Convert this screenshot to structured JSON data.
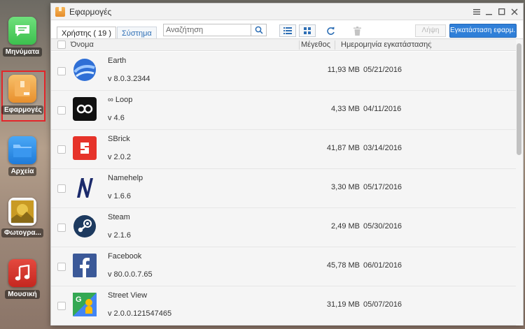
{
  "dock": {
    "items": [
      {
        "label": "Μηνύματα",
        "icon": "message-icon",
        "color": "#4cd964"
      },
      {
        "label": "Εφαρμογές",
        "icon": "apps-box-icon",
        "color": "#f0a23e"
      },
      {
        "label": "Αρχεία",
        "icon": "folder-icon",
        "color": "#2a8ee8"
      },
      {
        "label": "Φωτογρα...",
        "icon": "photo-icon",
        "color": "#c99a24"
      },
      {
        "label": "Μουσική",
        "icon": "music-icon",
        "color": "#d9342b"
      }
    ]
  },
  "window": {
    "title": "Εφαρμογές",
    "tabs": [
      {
        "label": "Χρήστης ( 19 )"
      },
      {
        "label": "Σύστημα"
      }
    ],
    "search": {
      "placeholder": "Αναζήτηση"
    },
    "uninstall_label": "Λήψη",
    "install_label": "Εγκατάσταση εφαρμ..."
  },
  "table": {
    "columns": {
      "name": "Όνομα",
      "size": "Μέγεθος",
      "date": "Ημερομηνία εγκατάστασης"
    },
    "rows": [
      {
        "name": "Earth",
        "version": "v 8.0.3.2344",
        "size": "11,93 MB",
        "date": "05/21/2016",
        "icon": "google-earth-icon"
      },
      {
        "name": "∞ Loop",
        "version": "v 4.6",
        "size": "4,33 MB",
        "date": "04/11/2016",
        "icon": "infinity-loop-icon"
      },
      {
        "name": "SBrick",
        "version": "v 2.0.2",
        "size": "41,87 MB",
        "date": "03/14/2016",
        "icon": "sbrick-icon"
      },
      {
        "name": "Namehelp",
        "version": "v 1.6.6",
        "size": "3,30 MB",
        "date": "05/17/2016",
        "icon": "namehelp-icon"
      },
      {
        "name": "Steam",
        "version": "v 2.1.6",
        "size": "2,49 MB",
        "date": "05/30/2016",
        "icon": "steam-icon"
      },
      {
        "name": "Facebook",
        "version": "v 80.0.0.7.65",
        "size": "45,78 MB",
        "date": "06/01/2016",
        "icon": "facebook-icon"
      },
      {
        "name": "Street View",
        "version": "v 2.0.0.121547465",
        "size": "31,19 MB",
        "date": "05/07/2016",
        "icon": "street-view-icon"
      }
    ]
  }
}
